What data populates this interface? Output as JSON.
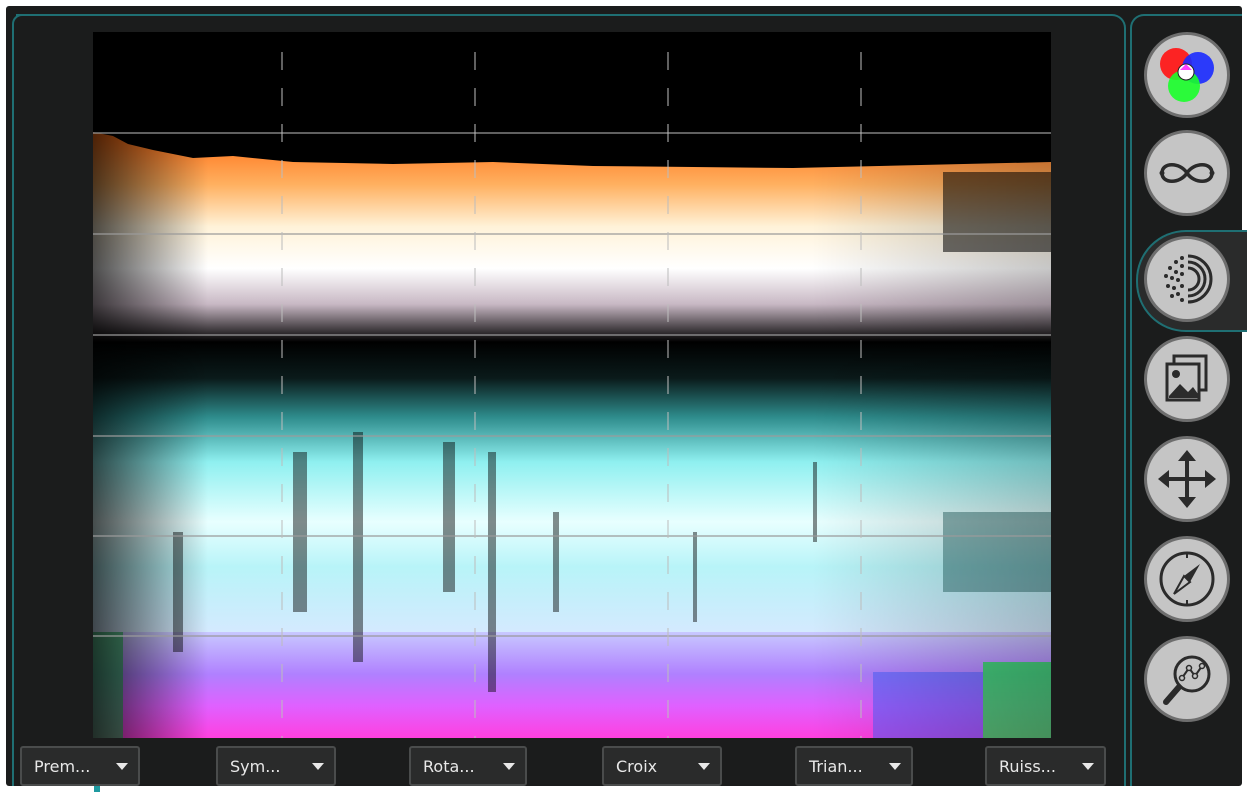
{
  "dropdowns": [
    {
      "id": "prem",
      "label": "Prem..."
    },
    {
      "id": "sym",
      "label": "Sym..."
    },
    {
      "id": "rota",
      "label": "Rota..."
    },
    {
      "id": "croix",
      "label": "Croix"
    },
    {
      "id": "trian",
      "label": "Trian..."
    },
    {
      "id": "ruiss",
      "label": "Ruiss..."
    }
  ],
  "tools": [
    {
      "icon": "color-circles-icon"
    },
    {
      "icon": "infinity-icon"
    },
    {
      "icon": "dot-arcs-icon",
      "active": true
    },
    {
      "icon": "image-gallery-icon"
    },
    {
      "icon": "move-arrows-icon"
    },
    {
      "icon": "compass-icon"
    },
    {
      "icon": "search-graph-icon"
    }
  ],
  "colors": {
    "accent": "#1f6f73",
    "panel": "#1b1c1c",
    "button": "#2a2b2b"
  }
}
